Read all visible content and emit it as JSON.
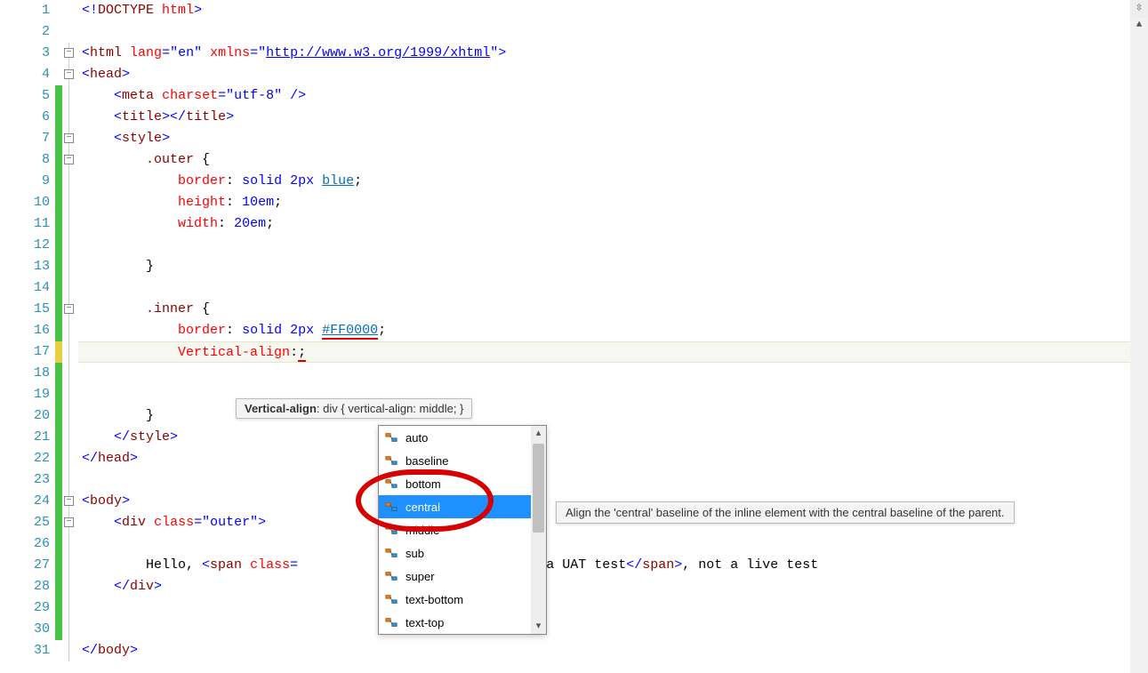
{
  "editor": {
    "current_line": 17,
    "lines": [
      {
        "n": 1,
        "change": "",
        "fold": "",
        "html": "<span class='t-blue'>&lt;!</span><span class='t-brown'>DOCTYPE</span> <span class='t-attr'>html</span><span class='t-blue'>&gt;</span>"
      },
      {
        "n": 2,
        "change": "",
        "fold": "",
        "html": ""
      },
      {
        "n": 3,
        "change": "",
        "fold": "box",
        "html": "<span class='t-blue'>&lt;</span><span class='t-brown'>html</span> <span class='t-attr'>lang</span><span class='t-blue'>=</span><span class='t-blue'>\"en\"</span> <span class='t-attr'>xmlns</span><span class='t-blue'>=</span><span class='t-blue'>\"</span><span class='t-link'>http://www.w3.org/1999/xhtml</span><span class='t-blue'>\"&gt;</span>"
      },
      {
        "n": 4,
        "change": "",
        "fold": "box",
        "html": "<span class='t-blue'>&lt;</span><span class='t-brown'>head</span><span class='t-blue'>&gt;</span>"
      },
      {
        "n": 5,
        "change": "green",
        "fold": "line",
        "html": "    <span class='t-blue'>&lt;</span><span class='t-brown'>meta</span> <span class='t-attr'>charset</span><span class='t-blue'>=\"utf-8\"</span> <span class='t-blue'>/&gt;</span>"
      },
      {
        "n": 6,
        "change": "green",
        "fold": "line",
        "html": "    <span class='t-blue'>&lt;</span><span class='t-brown'>title</span><span class='t-blue'>&gt;&lt;/</span><span class='t-brown'>title</span><span class='t-blue'>&gt;</span>"
      },
      {
        "n": 7,
        "change": "green",
        "fold": "box",
        "html": "    <span class='t-blue'>&lt;</span><span class='t-brown'>style</span><span class='t-blue'>&gt;</span>"
      },
      {
        "n": 8,
        "change": "green",
        "fold": "box",
        "html": "        <span class='t-brown'>.outer</span> {"
      },
      {
        "n": 9,
        "change": "green",
        "fold": "line",
        "html": "            <span class='t-attr'>border</span>: <span class='t-blue'>solid 2px</span> <span class='t-blue2'>blue</span>;"
      },
      {
        "n": 10,
        "change": "green",
        "fold": "line",
        "html": "            <span class='t-attr'>height</span>: <span class='t-blue'>10em</span>;"
      },
      {
        "n": 11,
        "change": "green",
        "fold": "line",
        "html": "            <span class='t-attr'>width</span>: <span class='t-blue'>20em</span>;"
      },
      {
        "n": 12,
        "change": "green",
        "fold": "line",
        "html": ""
      },
      {
        "n": 13,
        "change": "green",
        "fold": "line",
        "html": "        }"
      },
      {
        "n": 14,
        "change": "green",
        "fold": "line",
        "html": ""
      },
      {
        "n": 15,
        "change": "green",
        "fold": "box",
        "html": "        <span class='t-brown'>.inner</span> {"
      },
      {
        "n": 16,
        "change": "green",
        "fold": "line",
        "html": "            <span class='t-attr'>border</span>: <span class='t-blue'>solid 2px</span> <span class='t-blue2 t-err'>#FF0000</span>;"
      },
      {
        "n": 17,
        "change": "yellow",
        "fold": "line",
        "html": "            <span class='t-attr'>Vertical-align</span>:<span class='t-err'>;</span>"
      },
      {
        "n": 18,
        "change": "green",
        "fold": "line",
        "html": ""
      },
      {
        "n": 19,
        "change": "green",
        "fold": "line",
        "html": ""
      },
      {
        "n": 20,
        "change": "green",
        "fold": "line",
        "html": "        }"
      },
      {
        "n": 21,
        "change": "green",
        "fold": "line",
        "html": "    <span class='t-blue'>&lt;/</span><span class='t-brown'>style</span><span class='t-blue'>&gt;</span>"
      },
      {
        "n": 22,
        "change": "green",
        "fold": "line",
        "html": "<span class='t-blue'>&lt;/</span><span class='t-brown'>head</span><span class='t-blue'>&gt;</span>"
      },
      {
        "n": 23,
        "change": "green",
        "fold": "line",
        "html": ""
      },
      {
        "n": 24,
        "change": "green",
        "fold": "box",
        "html": "<span class='t-blue'>&lt;</span><span class='t-brown'>body</span><span class='t-blue'>&gt;</span>"
      },
      {
        "n": 25,
        "change": "green",
        "fold": "box",
        "html": "    <span class='t-blue'>&lt;</span><span class='t-brown'>div</span> <span class='t-attr'>class</span><span class='t-blue'>=\"outer\"&gt;</span>"
      },
      {
        "n": 26,
        "change": "green",
        "fold": "line",
        "html": ""
      },
      {
        "n": 27,
        "change": "green",
        "fold": "line",
        "html": "        Hello, <span class='t-blue'>&lt;</span><span class='t-brown'>span</span> <span class='t-attr'>class</span><span class='t-blue'>=</span>                    test.<span class='t-blue'>&lt;</span><span class='t-brown'>br</span><span class='t-blue'>/&gt;</span> a UAT test<span class='t-blue'>&lt;/</span><span class='t-brown'>span</span><span class='t-blue'>&gt;</span>, not a live test"
      },
      {
        "n": 28,
        "change": "green",
        "fold": "line",
        "html": "    <span class='t-blue'>&lt;/</span><span class='t-brown'>div</span><span class='t-blue'>&gt;</span>"
      },
      {
        "n": 29,
        "change": "green",
        "fold": "line",
        "html": ""
      },
      {
        "n": 30,
        "change": "green",
        "fold": "line",
        "html": ""
      },
      {
        "n": 31,
        "change": "",
        "fold": "line",
        "html": "<span class='t-blue'>&lt;/</span><span class='t-brown'>body</span><span class='t-blue'>&gt;</span>"
      }
    ]
  },
  "tooltip": {
    "label": "Vertical-align",
    "detail": ": div { vertical-align: middle; }"
  },
  "autocomplete": {
    "selected_index": 3,
    "items": [
      "auto",
      "baseline",
      "bottom",
      "central",
      "middle",
      "sub",
      "super",
      "text-bottom",
      "text-top"
    ]
  },
  "infotip": {
    "text": "Align the 'central' baseline of the inline element with the central baseline of the parent."
  }
}
